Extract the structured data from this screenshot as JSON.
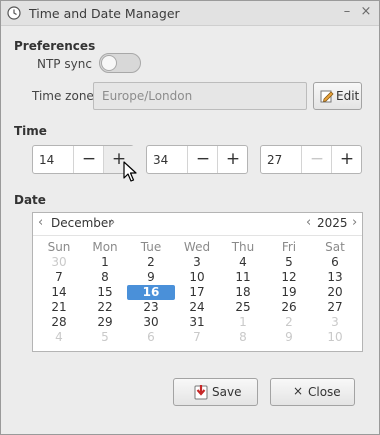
{
  "window": {
    "title": "Time and Date Manager",
    "minimize_glyph": "–",
    "close_glyph": "×"
  },
  "preferences": {
    "section_title": "Preferences",
    "ntp_label": "NTP sync",
    "ntp_enabled": false,
    "timezone_label": "Time zone",
    "timezone_value": "Europe/London",
    "edit_label": "Edit"
  },
  "time": {
    "section_title": "Time",
    "hours": "14",
    "minutes": "34",
    "seconds": "27",
    "minus_glyph": "−",
    "plus_glyph": "+"
  },
  "date": {
    "section_title": "Date",
    "month": "December",
    "year": "2025",
    "prev_glyph": "‹",
    "next_glyph": "›",
    "weekdays": [
      "Sun",
      "Mon",
      "Tue",
      "Wed",
      "Thu",
      "Fri",
      "Sat"
    ],
    "weeks": [
      [
        {
          "d": "30",
          "o": true
        },
        {
          "d": "1"
        },
        {
          "d": "2"
        },
        {
          "d": "3"
        },
        {
          "d": "4"
        },
        {
          "d": "5"
        },
        {
          "d": "6"
        }
      ],
      [
        {
          "d": "7"
        },
        {
          "d": "8"
        },
        {
          "d": "9"
        },
        {
          "d": "10"
        },
        {
          "d": "11"
        },
        {
          "d": "12"
        },
        {
          "d": "13"
        }
      ],
      [
        {
          "d": "14"
        },
        {
          "d": "15"
        },
        {
          "d": "16",
          "s": true
        },
        {
          "d": "17"
        },
        {
          "d": "18"
        },
        {
          "d": "19"
        },
        {
          "d": "20"
        }
      ],
      [
        {
          "d": "21"
        },
        {
          "d": "22"
        },
        {
          "d": "23"
        },
        {
          "d": "24"
        },
        {
          "d": "25"
        },
        {
          "d": "26"
        },
        {
          "d": "27"
        }
      ],
      [
        {
          "d": "28"
        },
        {
          "d": "29"
        },
        {
          "d": "30"
        },
        {
          "d": "31"
        },
        {
          "d": "1",
          "o": true
        },
        {
          "d": "2",
          "o": true
        },
        {
          "d": "3",
          "o": true
        }
      ],
      [
        {
          "d": "4",
          "o": true
        },
        {
          "d": "5",
          "o": true
        },
        {
          "d": "6",
          "o": true
        },
        {
          "d": "7",
          "o": true
        },
        {
          "d": "8",
          "o": true
        },
        {
          "d": "9",
          "o": true
        },
        {
          "d": "10",
          "o": true
        }
      ]
    ]
  },
  "actions": {
    "save_label": "Save",
    "close_label": "Close",
    "close_glyph": "×"
  },
  "colors": {
    "selected_day_bg": "#4a90d9",
    "window_bg": "#ececec"
  }
}
